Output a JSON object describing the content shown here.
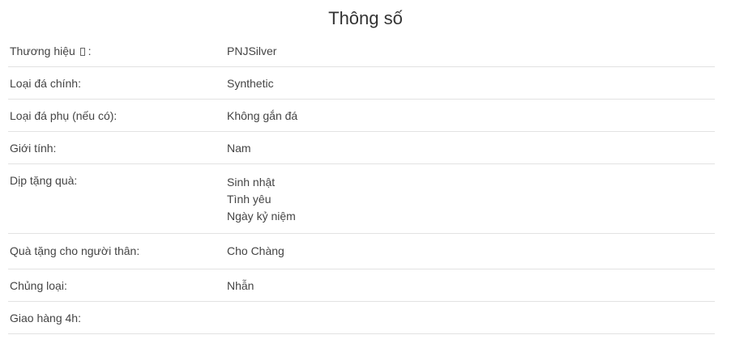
{
  "title": "Thông số",
  "specs": {
    "brand_label": "Thương hiệu",
    "brand_suffix": ":",
    "brand_value": "PNJSilver",
    "main_stone_label": "Loại đá chính:",
    "main_stone_value": "Synthetic",
    "secondary_stone_label": "Loại đá phụ (nếu có):",
    "secondary_stone_value": "Không gắn đá",
    "gender_label": "Giới tính:",
    "gender_value": "Nam",
    "occasion_label": "Dịp tặng quà:",
    "occasion_values": [
      "Sinh nhật",
      "Tình yêu",
      "Ngày kỷ niệm"
    ],
    "gift_for_label": "Quà tặng cho người thân:",
    "gift_for_value": "Cho Chàng",
    "category_label": "Chủng loại:",
    "category_value": "Nhẫn",
    "delivery_label": "Giao hàng 4h:",
    "delivery_value": ""
  }
}
